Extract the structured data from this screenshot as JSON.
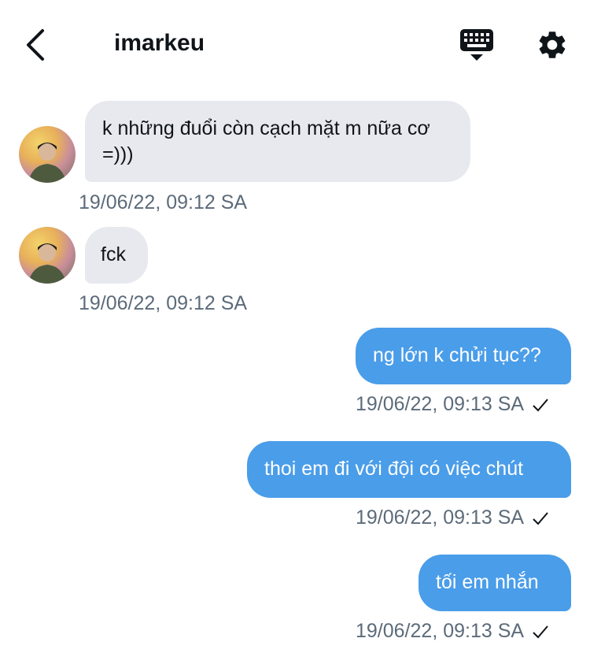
{
  "header": {
    "title": "imarkeu",
    "icons": {
      "back": "chevron-left-icon",
      "keyboard": "keyboard-icon",
      "settings": "gear-icon"
    }
  },
  "messages": [
    {
      "direction": "incoming",
      "text": "k những đuổi còn cạch mặt m nữa cơ =)))",
      "timestamp": "19/06/22, 09:12 SA"
    },
    {
      "direction": "incoming",
      "text": "fck",
      "timestamp": "19/06/22, 09:12 SA"
    },
    {
      "direction": "outgoing",
      "text": "ng lớn k chửi tục??",
      "timestamp": "19/06/22, 09:13 SA",
      "status": "sent"
    },
    {
      "direction": "outgoing",
      "text": "thoi em đi với đội có việc chút",
      "timestamp": "19/06/22, 09:13 SA",
      "status": "sent"
    },
    {
      "direction": "outgoing",
      "text": "tối em nhắn",
      "timestamp": "19/06/22, 09:13 SA",
      "status": "sent"
    }
  ],
  "colors": {
    "incoming_bubble": "#e7e9ee",
    "outgoing_bubble": "#4a9de9",
    "timestamp": "#5c6b7a",
    "text": "#0f1419"
  }
}
